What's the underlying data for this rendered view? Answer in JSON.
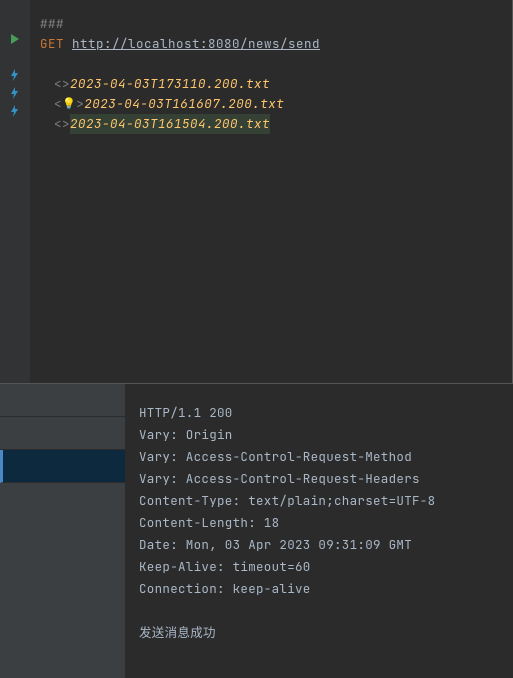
{
  "editor": {
    "separator": "###",
    "method": "GET",
    "url": "http://localhost:8080/news/send",
    "results": [
      {
        "marker": "<>",
        "name": "2023-04-03T173110.200.txt",
        "bulb": false,
        "selected": false
      },
      {
        "marker": "<",
        "name": "2023-04-03T161607.200.txt",
        "bulb": true,
        "selected": false
      },
      {
        "marker": "<>",
        "name": "2023-04-03T161504.200.txt",
        "bulb": false,
        "selected": true
      }
    ]
  },
  "response": {
    "lines": [
      "HTTP/1.1 200",
      "Vary: Origin",
      "Vary: Access-Control-Request-Method",
      "Vary: Access-Control-Request-Headers",
      "Content-Type: text/plain;charset=UTF-8",
      "Content-Length: 18",
      "Date: Mon, 03 Apr 2023 09:31:09 GMT",
      "Keep-Alive: timeout=60",
      "Connection: keep-alive",
      "",
      "发送消息成功"
    ]
  }
}
